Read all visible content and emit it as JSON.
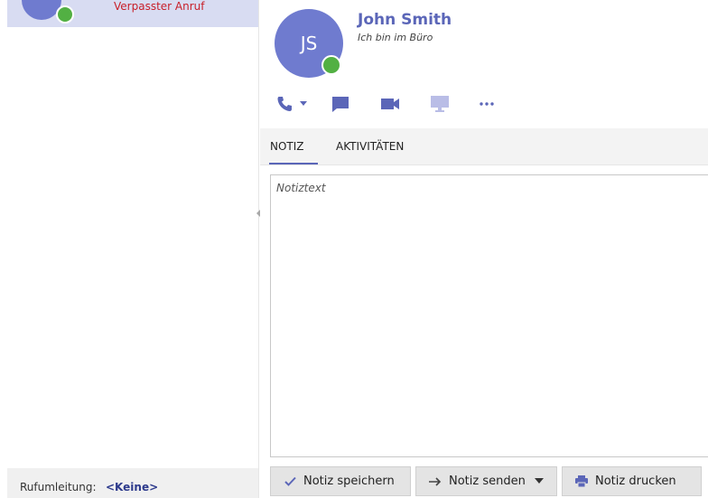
{
  "call_list": {
    "items": [
      {
        "status": "Verpasster Anruf"
      }
    ]
  },
  "footer": {
    "forward_label": "Rufumleitung:",
    "forward_value": "<Keine>"
  },
  "contact": {
    "initials": "JS",
    "name": "John Smith",
    "status": "Ich bin im Büro"
  },
  "actions": {
    "icons": [
      "phone-icon",
      "chevron-down-icon",
      "chat-icon",
      "video-icon",
      "screen-share-icon",
      "more-icon"
    ]
  },
  "tabs": [
    {
      "label": "NOTIZ",
      "active": true
    },
    {
      "label": "AKTIVITÄTEN",
      "active": false
    }
  ],
  "note": {
    "placeholder": "Notiztext"
  },
  "buttons": {
    "save": "Notiz speichern",
    "send": "Notiz senden",
    "print": "Notiz drucken"
  },
  "colors": {
    "accent": "#5b66b8",
    "avatar": "#6f7bcf",
    "presence_available": "#52b043",
    "missed_call": "#c8202a",
    "selection": "#d8dcf2"
  }
}
